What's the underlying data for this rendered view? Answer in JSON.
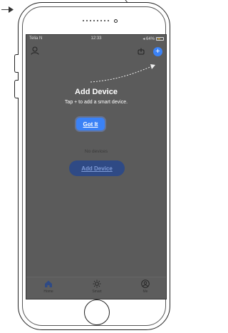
{
  "status_bar": {
    "carrier": "Telia N",
    "time": "12:33",
    "battery_indicator": "◂ 64%"
  },
  "hint": {
    "title": "Add Device",
    "subtitle": "Tap + to add a smart device."
  },
  "buttons": {
    "got_it": "Got It",
    "add_device": "Add Device",
    "plus": "+"
  },
  "empty_state": {
    "text": "No devices"
  },
  "tab_bar": {
    "tabs": [
      {
        "label": "Home",
        "icon": "home-icon"
      },
      {
        "label": "Smart",
        "icon": "sun-icon"
      },
      {
        "label": "Me",
        "icon": "user-icon"
      }
    ]
  },
  "colors": {
    "accent": "#3b82f6",
    "overlay": "#5b5b5b",
    "battery": "#f2c037"
  }
}
